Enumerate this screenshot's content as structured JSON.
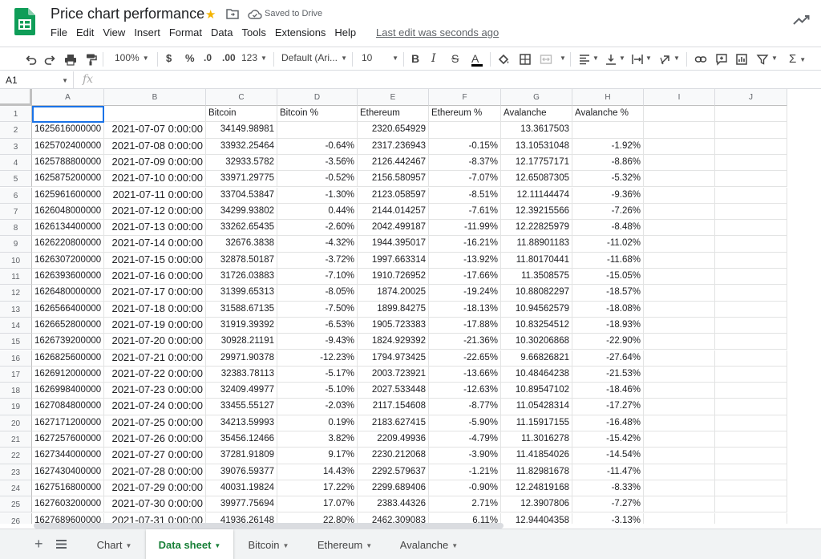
{
  "app": {
    "title": "Price chart performance",
    "saved_status": "Saved to Drive",
    "last_edit": "Last edit was seconds ago",
    "menu": [
      "File",
      "Edit",
      "View",
      "Insert",
      "Format",
      "Data",
      "Tools",
      "Extensions",
      "Help"
    ]
  },
  "toolbar": {
    "zoom": "100%",
    "currency": "$",
    "percent": "%",
    "dec_decrease": ".0",
    "dec_increase": ".00",
    "more_formats": "123",
    "font": "Default (Ari...",
    "font_size": "10",
    "bold": "B",
    "italic": "I",
    "strike": "S",
    "text_color": "A",
    "text_color_bar": "#000000"
  },
  "formula_bar": {
    "name_box": "A1",
    "fx": "fx",
    "value": ""
  },
  "columns": [
    "A",
    "B",
    "C",
    "D",
    "E",
    "F",
    "G",
    "H",
    "I",
    "J"
  ],
  "rows": [
    {
      "n": "1",
      "a": "",
      "b": "",
      "c": "Bitcoin",
      "d": "Bitcoin %",
      "e": "Ethereum",
      "f": "Ethereum %",
      "g": "Avalanche",
      "h": "Avalanche %"
    },
    {
      "n": "2",
      "a": "1625616000000",
      "b": "2021-07-07 0:00:00",
      "c": "34149.98981",
      "d": "",
      "e": "2320.654929",
      "f": "",
      "g": "13.3617503",
      "h": ""
    },
    {
      "n": "3",
      "a": "1625702400000",
      "b": "2021-07-08 0:00:00",
      "c": "33932.25464",
      "d": "-0.64%",
      "e": "2317.236943",
      "f": "-0.15%",
      "g": "13.10531048",
      "h": "-1.92%"
    },
    {
      "n": "4",
      "a": "1625788800000",
      "b": "2021-07-09 0:00:00",
      "c": "32933.5782",
      "d": "-3.56%",
      "e": "2126.442467",
      "f": "-8.37%",
      "g": "12.17757171",
      "h": "-8.86%"
    },
    {
      "n": "5",
      "a": "1625875200000",
      "b": "2021-07-10 0:00:00",
      "c": "33971.29775",
      "d": "-0.52%",
      "e": "2156.580957",
      "f": "-7.07%",
      "g": "12.65087305",
      "h": "-5.32%"
    },
    {
      "n": "6",
      "a": "1625961600000",
      "b": "2021-07-11 0:00:00",
      "c": "33704.53847",
      "d": "-1.30%",
      "e": "2123.058597",
      "f": "-8.51%",
      "g": "12.11144474",
      "h": "-9.36%"
    },
    {
      "n": "7",
      "a": "1626048000000",
      "b": "2021-07-12 0:00:00",
      "c": "34299.93802",
      "d": "0.44%",
      "e": "2144.014257",
      "f": "-7.61%",
      "g": "12.39215566",
      "h": "-7.26%"
    },
    {
      "n": "8",
      "a": "1626134400000",
      "b": "2021-07-13 0:00:00",
      "c": "33262.65435",
      "d": "-2.60%",
      "e": "2042.499187",
      "f": "-11.99%",
      "g": "12.22825979",
      "h": "-8.48%"
    },
    {
      "n": "9",
      "a": "1626220800000",
      "b": "2021-07-14 0:00:00",
      "c": "32676.3838",
      "d": "-4.32%",
      "e": "1944.395017",
      "f": "-16.21%",
      "g": "11.88901183",
      "h": "-11.02%"
    },
    {
      "n": "10",
      "a": "1626307200000",
      "b": "2021-07-15 0:00:00",
      "c": "32878.50187",
      "d": "-3.72%",
      "e": "1997.663314",
      "f": "-13.92%",
      "g": "11.80170441",
      "h": "-11.68%"
    },
    {
      "n": "11",
      "a": "1626393600000",
      "b": "2021-07-16 0:00:00",
      "c": "31726.03883",
      "d": "-7.10%",
      "e": "1910.726952",
      "f": "-17.66%",
      "g": "11.3508575",
      "h": "-15.05%"
    },
    {
      "n": "12",
      "a": "1626480000000",
      "b": "2021-07-17 0:00:00",
      "c": "31399.65313",
      "d": "-8.05%",
      "e": "1874.20025",
      "f": "-19.24%",
      "g": "10.88082297",
      "h": "-18.57%"
    },
    {
      "n": "13",
      "a": "1626566400000",
      "b": "2021-07-18 0:00:00",
      "c": "31588.67135",
      "d": "-7.50%",
      "e": "1899.84275",
      "f": "-18.13%",
      "g": "10.94562579",
      "h": "-18.08%"
    },
    {
      "n": "14",
      "a": "1626652800000",
      "b": "2021-07-19 0:00:00",
      "c": "31919.39392",
      "d": "-6.53%",
      "e": "1905.723383",
      "f": "-17.88%",
      "g": "10.83254512",
      "h": "-18.93%"
    },
    {
      "n": "15",
      "a": "1626739200000",
      "b": "2021-07-20 0:00:00",
      "c": "30928.21191",
      "d": "-9.43%",
      "e": "1824.929392",
      "f": "-21.36%",
      "g": "10.30206868",
      "h": "-22.90%"
    },
    {
      "n": "16",
      "a": "1626825600000",
      "b": "2021-07-21 0:00:00",
      "c": "29971.90378",
      "d": "-12.23%",
      "e": "1794.973425",
      "f": "-22.65%",
      "g": "9.66826821",
      "h": "-27.64%"
    },
    {
      "n": "17",
      "a": "1626912000000",
      "b": "2021-07-22 0:00:00",
      "c": "32383.78113",
      "d": "-5.17%",
      "e": "2003.723921",
      "f": "-13.66%",
      "g": "10.48464238",
      "h": "-21.53%"
    },
    {
      "n": "18",
      "a": "1626998400000",
      "b": "2021-07-23 0:00:00",
      "c": "32409.49977",
      "d": "-5.10%",
      "e": "2027.533448",
      "f": "-12.63%",
      "g": "10.89547102",
      "h": "-18.46%"
    },
    {
      "n": "19",
      "a": "1627084800000",
      "b": "2021-07-24 0:00:00",
      "c": "33455.55127",
      "d": "-2.03%",
      "e": "2117.154608",
      "f": "-8.77%",
      "g": "11.05428314",
      "h": "-17.27%"
    },
    {
      "n": "20",
      "a": "1627171200000",
      "b": "2021-07-25 0:00:00",
      "c": "34213.59993",
      "d": "0.19%",
      "e": "2183.627415",
      "f": "-5.90%",
      "g": "11.15917155",
      "h": "-16.48%"
    },
    {
      "n": "21",
      "a": "1627257600000",
      "b": "2021-07-26 0:00:00",
      "c": "35456.12466",
      "d": "3.82%",
      "e": "2209.49936",
      "f": "-4.79%",
      "g": "11.3016278",
      "h": "-15.42%"
    },
    {
      "n": "22",
      "a": "1627344000000",
      "b": "2021-07-27 0:00:00",
      "c": "37281.91809",
      "d": "9.17%",
      "e": "2230.212068",
      "f": "-3.90%",
      "g": "11.41854026",
      "h": "-14.54%"
    },
    {
      "n": "23",
      "a": "1627430400000",
      "b": "2021-07-28 0:00:00",
      "c": "39076.59377",
      "d": "14.43%",
      "e": "2292.579637",
      "f": "-1.21%",
      "g": "11.82981678",
      "h": "-11.47%"
    },
    {
      "n": "24",
      "a": "1627516800000",
      "b": "2021-07-29 0:00:00",
      "c": "40031.19824",
      "d": "17.22%",
      "e": "2299.689406",
      "f": "-0.90%",
      "g": "12.24819168",
      "h": "-8.33%"
    },
    {
      "n": "25",
      "a": "1627603200000",
      "b": "2021-07-30 0:00:00",
      "c": "39977.75694",
      "d": "17.07%",
      "e": "2383.44326",
      "f": "2.71%",
      "g": "12.3907806",
      "h": "-7.27%"
    },
    {
      "n": "26",
      "a": "1627689600000",
      "b": "2021-07-31 0:00:00",
      "c": "41936.26148",
      "d": "22.80%",
      "e": "2462.309083",
      "f": "6.11%",
      "g": "12.94404358",
      "h": "-3.13%"
    }
  ],
  "tabs": [
    {
      "label": "Chart",
      "active": false
    },
    {
      "label": "Data sheet",
      "active": true
    },
    {
      "label": "Bitcoin",
      "active": false
    },
    {
      "label": "Ethereum",
      "active": false
    },
    {
      "label": "Avalanche",
      "active": false
    }
  ],
  "colors": {
    "sheets_green": "#0f9d58",
    "selection_blue": "#1a73e8",
    "active_tab_green": "#188038",
    "star_yellow": "#f4b400"
  },
  "icons": [
    "sheets-logo-icon",
    "star-icon",
    "move-folder-icon",
    "cloud-saved-icon",
    "trend-icon",
    "undo-icon",
    "redo-icon",
    "print-icon",
    "paint-format-icon",
    "fill-color-icon",
    "borders-icon",
    "merge-icon",
    "align-icon",
    "valign-icon",
    "wrap-icon",
    "rotate-icon",
    "link-icon",
    "comment-icon",
    "chart-icon",
    "filter-icon",
    "functions-icon",
    "add-sheet-icon",
    "all-sheets-icon"
  ]
}
